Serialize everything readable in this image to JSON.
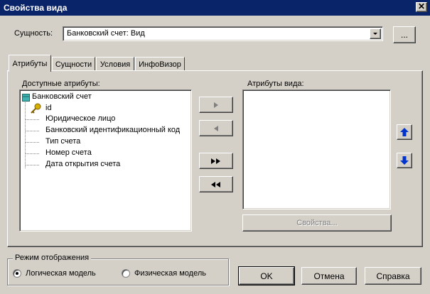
{
  "window": {
    "title": "Свойства вида",
    "close_label": "✕"
  },
  "entity": {
    "label": "Сущность:",
    "value": "Банковский счет: Вид",
    "browse_label": "..."
  },
  "tabs": [
    {
      "label": "Атрибуты",
      "active": true
    },
    {
      "label": "Сущности",
      "active": false
    },
    {
      "label": "Условия",
      "active": false
    },
    {
      "label": "ИнфоВизор",
      "active": false
    }
  ],
  "available": {
    "label": "Доступные атрибуты:",
    "root": "Банковский счет",
    "items": [
      "id",
      "Юридическое лицо",
      "Банковский идентификационный код",
      "Тип счета",
      "Номер счета",
      "Дата открытия счета"
    ]
  },
  "view_attrs": {
    "label": "Атрибуты вида:",
    "properties_label": "Свойства..."
  },
  "move_buttons": {
    "add": "▶",
    "remove": "◀",
    "add_all": "▶▶",
    "remove_all": "◀◀"
  },
  "order_buttons": {
    "up": "⬆",
    "down": "⬇"
  },
  "display_mode": {
    "label": "Режим отображения",
    "logical": "Логическая модель",
    "physical": "Физическая модель",
    "selected": "logical"
  },
  "footer": {
    "ok": "OK",
    "cancel": "Отмена",
    "help": "Справка"
  },
  "colors": {
    "title_bg": "#0a246a",
    "arrow_blue": "#0033cc",
    "entity_icon": "#3fb0b0"
  }
}
